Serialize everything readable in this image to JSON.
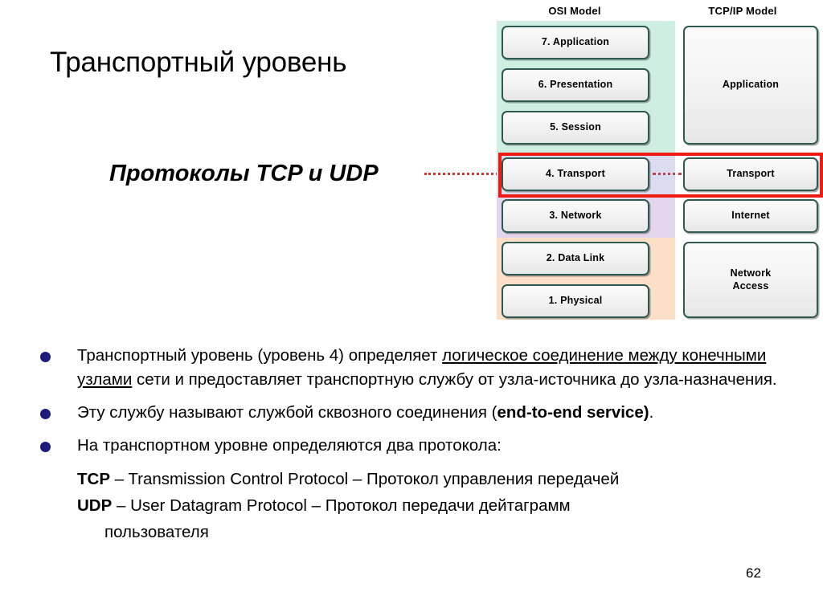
{
  "slide": {
    "title": "Транспортный уровень",
    "subtitle": "Протоколы TCP и UDP",
    "page_number": "62"
  },
  "diagram": {
    "osi_header": "OSI Model",
    "tcpip_header": "TCP/IP Model",
    "osi_layers": [
      {
        "label": "7. Application"
      },
      {
        "label": "6. Presentation"
      },
      {
        "label": "5. Session"
      },
      {
        "label": "4. Transport"
      },
      {
        "label": "3. Network"
      },
      {
        "label": "2. Data Link"
      },
      {
        "label": "1. Physical"
      }
    ],
    "tcpip_layers": [
      {
        "label": "Application"
      },
      {
        "label": "Transport"
      },
      {
        "label": "Internet"
      },
      {
        "label": "Network\nAccess"
      }
    ],
    "colors": {
      "band_application": "#cdeee1",
      "band_transport": "#dcdcf0",
      "band_network": "#e3d5ec",
      "band_link": "#fbdfc6",
      "box_border": "#2e5a52",
      "highlight": "#ee1b12",
      "connector": "#d6352b"
    }
  },
  "bullets": [
    {
      "part1": "Транспортный уровень (уровень 4)  определяет ",
      "underline1": "логическое соединение между конечными узлами",
      "part2": " сети и предоставляет транспортную службу от узла-источника до узла-назначения."
    },
    {
      "part1": "Эту службу называют службой сквозного соединения  (",
      "bold1": "end-to-end service)",
      "part2": "."
    },
    {
      "part1": "На транспортном уровне определяются два протокола:"
    }
  ],
  "protocols": [
    {
      "abbr": "TCP",
      "text": " – Transmission Control Protocol – Протокол управления передачей"
    },
    {
      "abbr": "UDP",
      "text": " – User Datagram Protocol – Протокол передачи дейтаграмм",
      "continuation": "пользователя"
    }
  ]
}
